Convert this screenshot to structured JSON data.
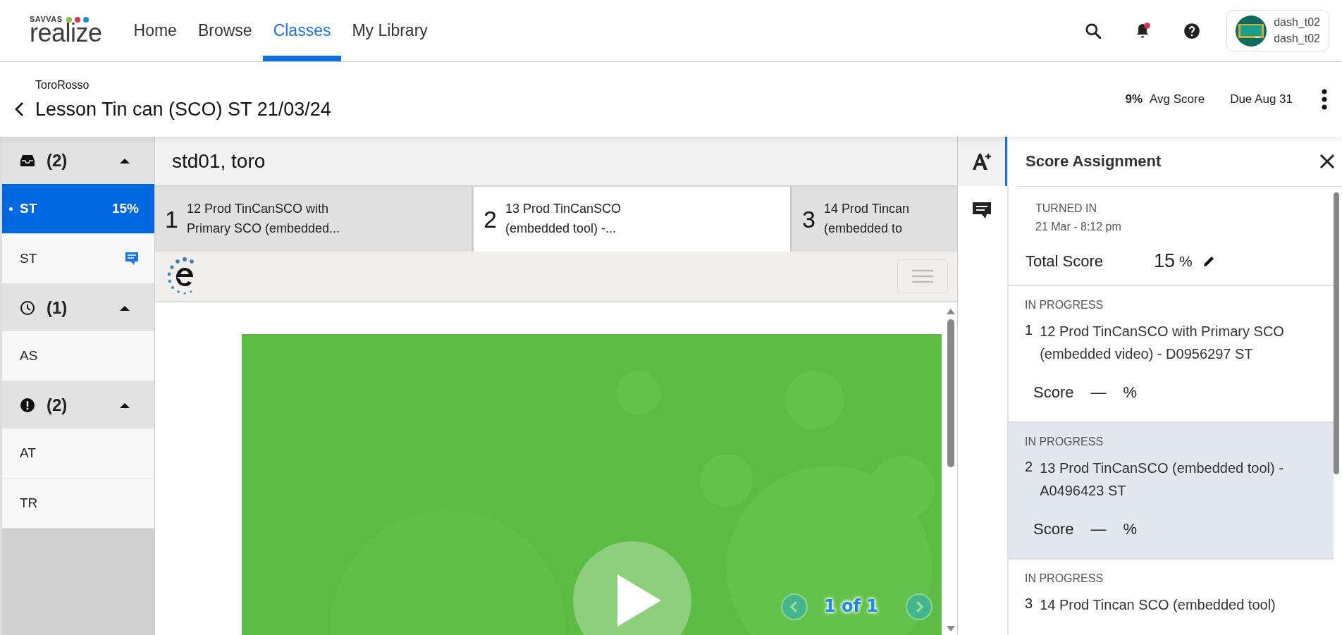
{
  "header": {
    "logo": {
      "top": "SAVVAS",
      "name": "realize"
    },
    "nav": [
      {
        "label": "Home",
        "selected": false
      },
      {
        "label": "Browse",
        "selected": false
      },
      {
        "label": "Classes",
        "selected": true
      },
      {
        "label": "My Library",
        "selected": false
      }
    ],
    "notifications": {
      "unread": true
    },
    "user": {
      "line1": "dash_t02",
      "line2": "dash_t02"
    }
  },
  "subheader": {
    "class_name": "ToroRosso",
    "title": "Lesson Tin can (SCO) ST 21/03/24",
    "avg_value": "9%",
    "avg_label": "Avg Score",
    "due": "Due Aug 31"
  },
  "sidebar": {
    "groups": [
      {
        "kind": "inbox",
        "count": "(2)",
        "expanded": true,
        "items": [
          {
            "name": "ST",
            "score": "15%",
            "selected": true,
            "comment": false
          },
          {
            "name": "ST",
            "selected": false,
            "comment": true
          }
        ]
      },
      {
        "kind": "clock",
        "count": "(1)",
        "expanded": true,
        "items": [
          {
            "name": "AS",
            "selected": false,
            "comment": false
          }
        ]
      },
      {
        "kind": "alert",
        "count": "(2)",
        "expanded": true,
        "items": [
          {
            "name": "AT",
            "selected": false,
            "comment": false
          },
          {
            "name": "TR",
            "selected": false,
            "comment": false
          }
        ]
      }
    ]
  },
  "student": {
    "name": "std01, toro"
  },
  "tabs": [
    {
      "number": "1",
      "lines": [
        "12 Prod TinCanSCO with",
        "Primary SCO (embedded..."
      ],
      "selected": false
    },
    {
      "number": "2",
      "lines": [
        "13 Prod TinCanSCO",
        "(embedded tool) -..."
      ],
      "selected": true
    },
    {
      "number": "3",
      "lines": [
        "14 Prod Tincan",
        "(embedded to"
      ],
      "selected": false
    }
  ],
  "player": {
    "counter": "1 of 1"
  },
  "tools": [
    {
      "kind": "grade",
      "selected": true
    },
    {
      "kind": "comment",
      "selected": false
    }
  ],
  "panel": {
    "title": "Score Assignment",
    "turned_in_label": "TURNED IN",
    "turned_in_date": "21 Mar - 8:12 pm",
    "total_label": "Total Score",
    "total_value": "15",
    "total_unit": "%",
    "items": [
      {
        "status": "IN PROGRESS",
        "number": "1",
        "title": "12 Prod TinCanSCO with Primary SCO (embedded video) - D0956297 ST",
        "score_label": "Score",
        "score_value": "—",
        "score_unit": "%",
        "selected": false
      },
      {
        "status": "IN PROGRESS",
        "number": "2",
        "title": "13 Prod TinCanSCO (embedded tool) - A0496423 ST",
        "score_label": "Score",
        "score_value": "—",
        "score_unit": "%",
        "selected": true
      },
      {
        "status": "IN PROGRESS",
        "number": "3",
        "title": "14 Prod Tincan SCO (embedded tool)",
        "selected": false
      }
    ]
  }
}
